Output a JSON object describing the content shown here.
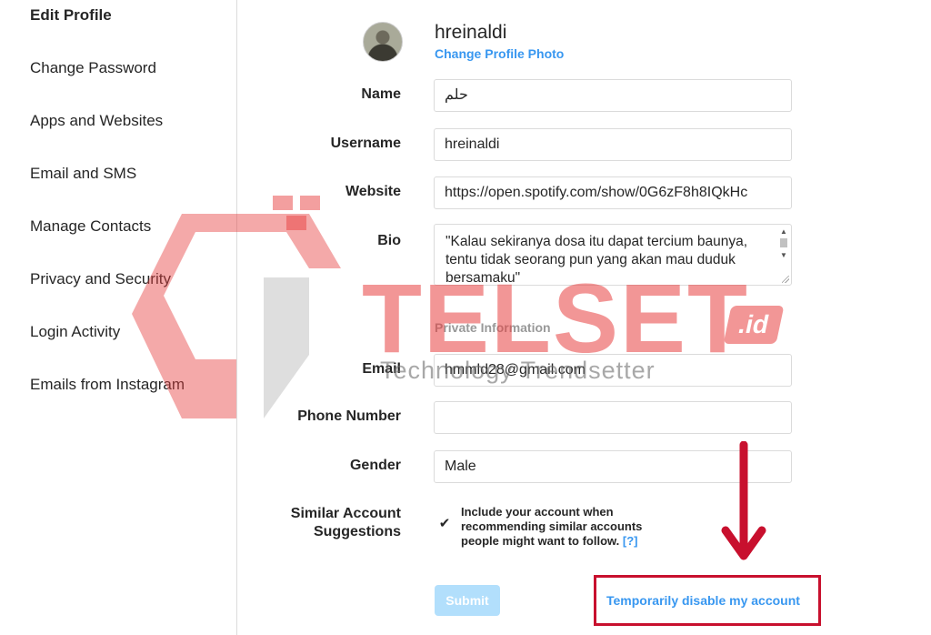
{
  "sidebar": {
    "items": [
      {
        "label": "Edit Profile",
        "active": true
      },
      {
        "label": "Change Password"
      },
      {
        "label": "Apps and Websites"
      },
      {
        "label": "Email and SMS"
      },
      {
        "label": "Manage Contacts"
      },
      {
        "label": "Privacy and Security"
      },
      {
        "label": "Login Activity"
      },
      {
        "label": "Emails from Instagram"
      }
    ]
  },
  "profile": {
    "username": "hreinaldi",
    "change_photo_label": "Change Profile Photo"
  },
  "form": {
    "name": {
      "label": "Name",
      "value": "حلم"
    },
    "username": {
      "label": "Username",
      "value": "hreinaldi"
    },
    "website": {
      "label": "Website",
      "value": "https://open.spotify.com/show/0G6zF8h8IQkHc"
    },
    "bio": {
      "label": "Bio",
      "value": "\"Kalau sekiranya dosa itu dapat tercium baunya, tentu tidak seorang pun yang akan mau duduk bersamaku\""
    },
    "private_heading": "Private Information",
    "email": {
      "label": "Email",
      "value": "hmmld28@gmail.com"
    },
    "phone": {
      "label": "Phone Number",
      "value": ""
    },
    "gender": {
      "label": "Gender",
      "value": "Male"
    },
    "similar": {
      "label_line1": "Similar Account",
      "label_line2": "Suggestions",
      "checked": true,
      "text": "Include your account when recommending similar accounts people might want to follow.",
      "help": "[?]"
    }
  },
  "actions": {
    "submit_label": "Submit",
    "disable_label": "Temporarily disable my account"
  },
  "watermark": {
    "brand": "TELSET",
    "badge": ".id",
    "tagline": "Technology Trendsetter"
  },
  "colors": {
    "link": "#3897f0",
    "submit_disabled": "#b2dffc",
    "highlight": "#c8102e",
    "watermark": "#e74040"
  },
  "icons": {
    "checkbox": "checkmark",
    "annotation": "down-arrow"
  }
}
